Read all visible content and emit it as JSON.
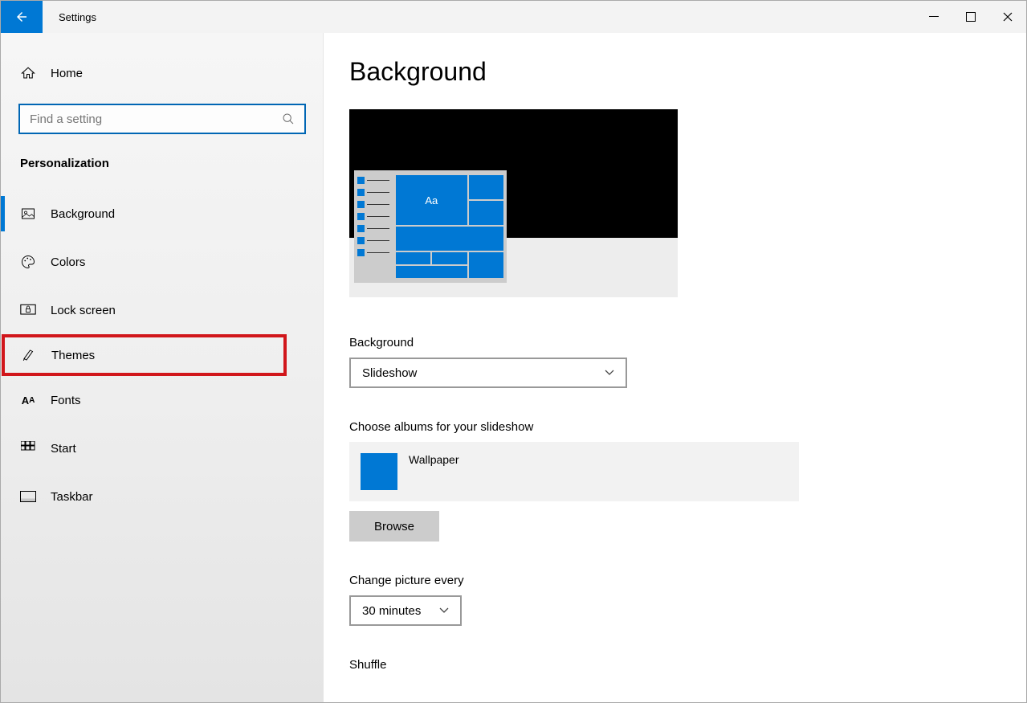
{
  "window": {
    "title": "Settings"
  },
  "sidebar": {
    "home": "Home",
    "search_placeholder": "Find a setting",
    "category": "Personalization",
    "items": [
      {
        "label": "Background",
        "icon": "picture"
      },
      {
        "label": "Colors",
        "icon": "palette"
      },
      {
        "label": "Lock screen",
        "icon": "lock-screen"
      },
      {
        "label": "Themes",
        "icon": "paint"
      },
      {
        "label": "Fonts",
        "icon": "font"
      },
      {
        "label": "Start",
        "icon": "grid"
      },
      {
        "label": "Taskbar",
        "icon": "taskbar"
      }
    ]
  },
  "main": {
    "heading": "Background",
    "preview_sample": "Aa",
    "bg_label": "Background",
    "bg_value": "Slideshow",
    "albums_label": "Choose albums for your slideshow",
    "album_name": "Wallpaper",
    "browse": "Browse",
    "interval_label": "Change picture every",
    "interval_value": "30 minutes",
    "shuffle_label": "Shuffle"
  }
}
